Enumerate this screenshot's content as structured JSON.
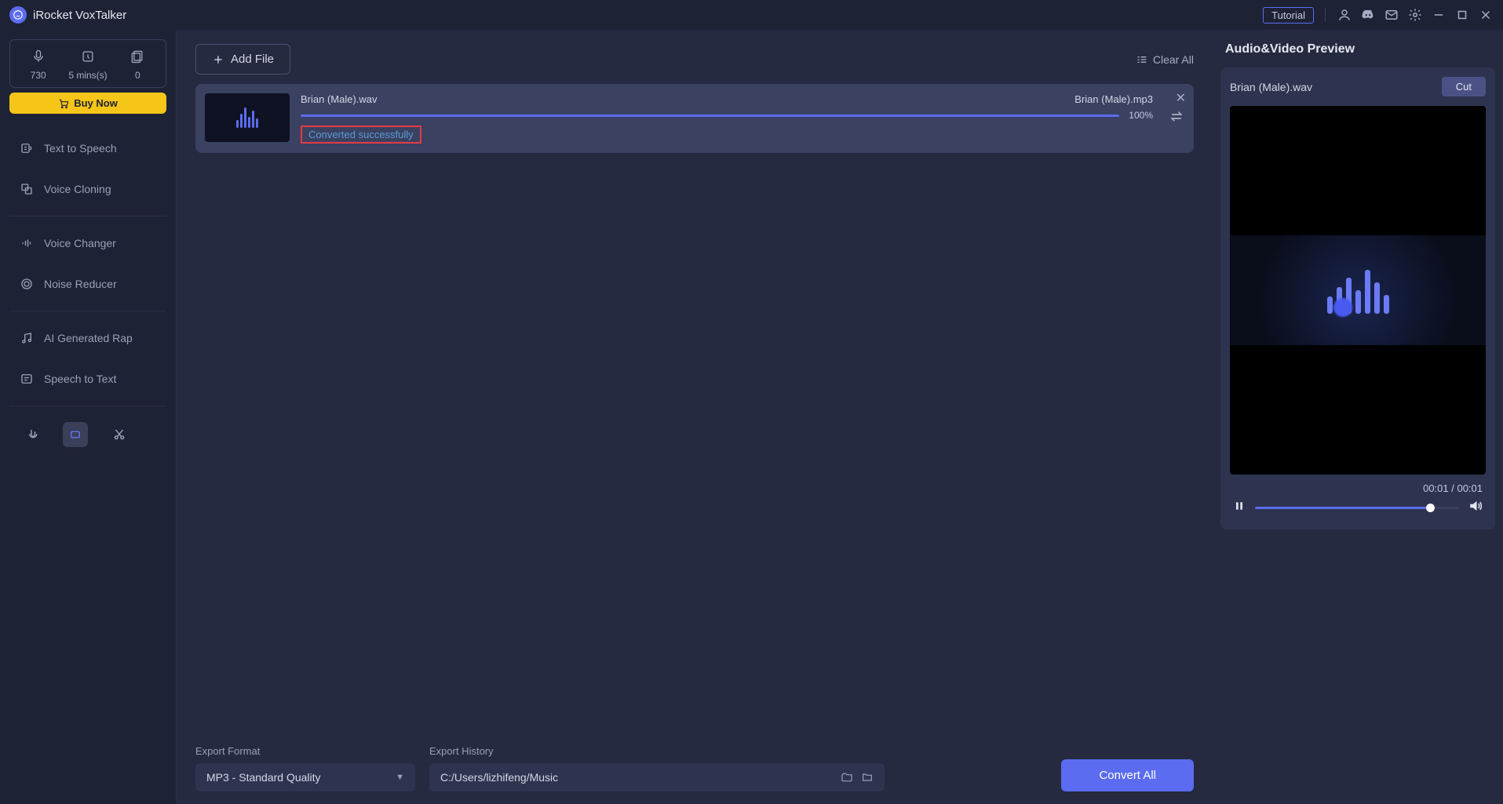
{
  "app_title": "iRocket VoxTalker",
  "tutorial": "Tutorial",
  "stats": {
    "s1": "730",
    "s2": "5 mins(s)",
    "s3": "0"
  },
  "buy_now": "Buy Now",
  "nav": {
    "tts": "Text to Speech",
    "cloning": "Voice Cloning",
    "changer": "Voice Changer",
    "noise": "Noise Reducer",
    "rap": "AI Generated Rap",
    "stt": "Speech to Text"
  },
  "add_file": "Add File",
  "clear_all": "Clear All",
  "file": {
    "src_name": "Brian (Male).wav",
    "dst_name": "Brian (Male).mp3",
    "percent": "100%",
    "status": "Converted successfully"
  },
  "footer": {
    "format_label": "Export Format",
    "format_value": "MP3 - Standard Quality",
    "history_label": "Export History",
    "history_value": "C:/Users/lizhifeng/Music",
    "convert": "Convert All"
  },
  "preview": {
    "title": "Audio&Video Preview",
    "name": "Brian (Male).wav",
    "cut": "Cut",
    "time": "00:01 / 00:01"
  }
}
